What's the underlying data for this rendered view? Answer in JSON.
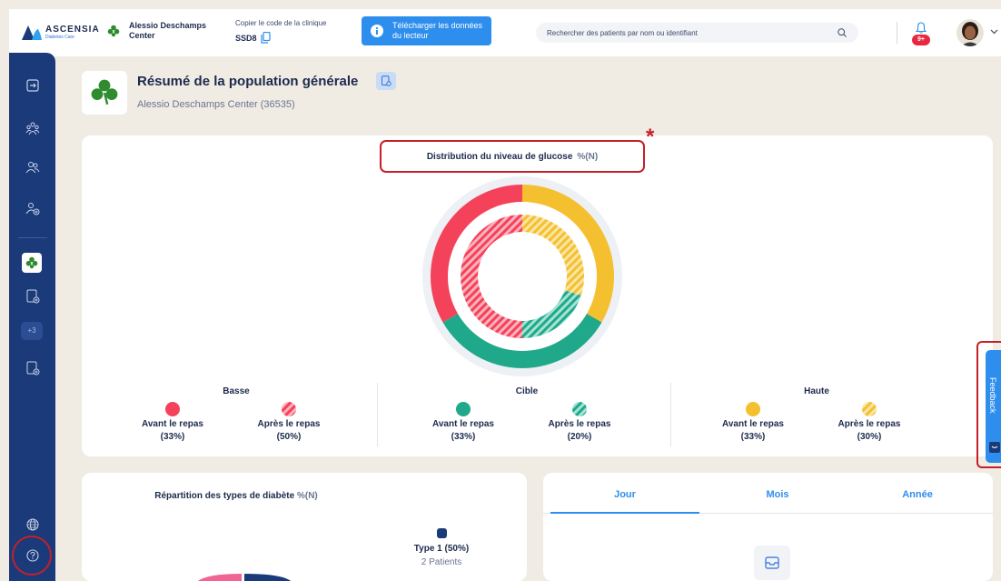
{
  "brand": {
    "name": "ASCENSIA",
    "tagline": "Diabetes Care",
    "color": "#2e6fd8"
  },
  "header": {
    "clinic_name": "Alessio Deschamps Center",
    "code_label": "Copier le code de la clinique",
    "code_value": "SSD8",
    "download_label": "Télécharger les données du lecteur",
    "search_placeholder": "Rechercher des patients par nom ou identifiant",
    "notification_count": "9+"
  },
  "sidebar": {
    "items": [
      "exit-icon",
      "population-icon",
      "patients-icon",
      "add-patient-icon",
      "clinic-clover-icon",
      "report-icon",
      "more-icon",
      "add-report-icon",
      "globe-icon",
      "help-icon"
    ],
    "more_label": "+3"
  },
  "page": {
    "title": "Résumé de la population générale",
    "subtitle": "Alessio Deschamps Center  (36535)"
  },
  "glucose_card": {
    "title": "Distribution du niveau de glucose",
    "unit": "%(N)",
    "asterisk": "*",
    "groups": [
      {
        "title": "Basse",
        "color": "#f4425a",
        "items": [
          {
            "label": "Avant le repas",
            "value": "(33%)"
          },
          {
            "label": "Après le repas",
            "value": "(50%)"
          }
        ]
      },
      {
        "title": "Cible",
        "color": "#1fa98a",
        "items": [
          {
            "label": "Avant le repas",
            "value": "(33%)"
          },
          {
            "label": "Après le repas",
            "value": "(20%)"
          }
        ]
      },
      {
        "title": "Haute",
        "color": "#f4c030",
        "items": [
          {
            "label": "Avant le repas",
            "value": "(33%)"
          },
          {
            "label": "Après le repas",
            "value": "(30%)"
          }
        ]
      }
    ]
  },
  "chart_data": {
    "type": "pie",
    "series": [
      {
        "name": "Avant le repas",
        "categories": [
          "Haute",
          "Cible",
          "Basse"
        ],
        "values": [
          33,
          33,
          33
        ]
      },
      {
        "name": "Après le repas",
        "categories": [
          "Haute",
          "Cible",
          "Basse"
        ],
        "values": [
          30,
          20,
          50
        ]
      }
    ],
    "colors": {
      "Basse": "#f4425a",
      "Cible": "#1fa98a",
      "Haute": "#f4c030"
    }
  },
  "diabetes_card": {
    "title": "Répartition des types de diabète",
    "unit": "%(N)",
    "type1_label": "Type 1  (50%)",
    "type1_count": "2 Patients"
  },
  "tabs": [
    "Jour",
    "Mois",
    "Année"
  ],
  "feedback_label": "Feedback"
}
